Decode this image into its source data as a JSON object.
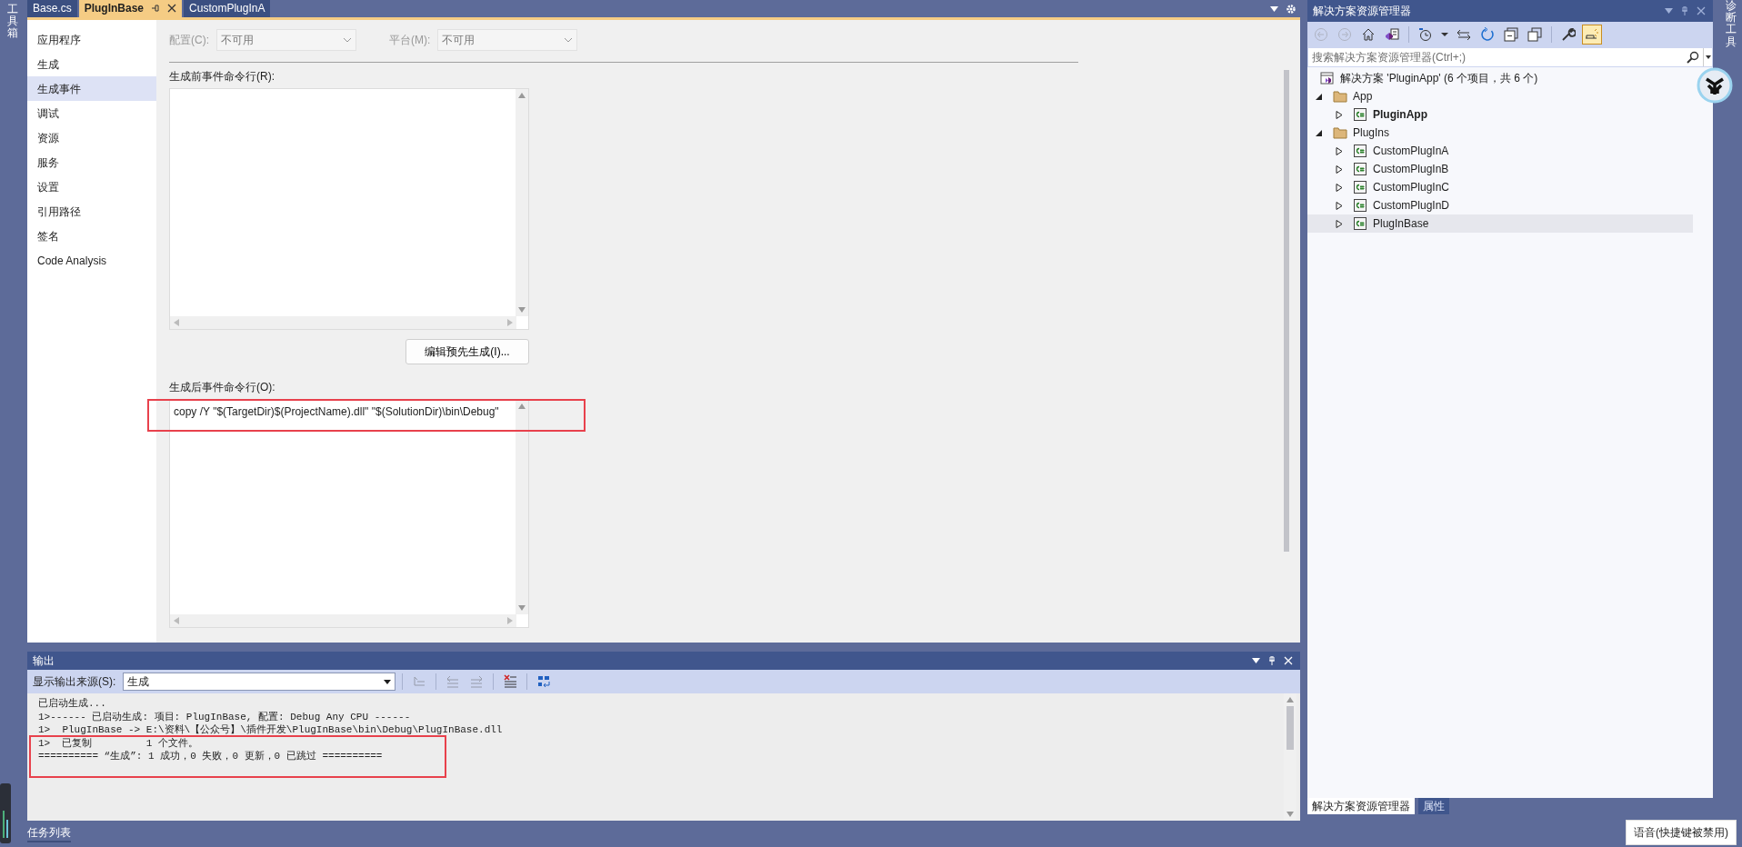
{
  "left_strip": {
    "label": "工具箱"
  },
  "doc_tabs": [
    {
      "label": "Base.cs",
      "selected": false
    },
    {
      "label": "PlugInBase",
      "selected": true
    },
    {
      "label": "CustomPlugInA",
      "selected": false
    }
  ],
  "nav": [
    {
      "label": "应用程序",
      "selected": false
    },
    {
      "label": "生成",
      "selected": false
    },
    {
      "label": "生成事件",
      "selected": true
    },
    {
      "label": "调试",
      "selected": false
    },
    {
      "label": "资源",
      "selected": false
    },
    {
      "label": "服务",
      "selected": false
    },
    {
      "label": "设置",
      "selected": false
    },
    {
      "label": "引用路径",
      "selected": false
    },
    {
      "label": "签名",
      "selected": false
    },
    {
      "label": "Code Analysis",
      "selected": false
    }
  ],
  "config": {
    "config_label": "配置(C):",
    "config_value": "不可用",
    "platform_label": "平台(M):",
    "platform_value": "不可用",
    "disabled": true
  },
  "pre_build": {
    "label": "生成前事件命令行(R):",
    "button": "编辑预先生成(I)..."
  },
  "post_build": {
    "label": "生成后事件命令行(O):",
    "value": "copy /Y \"$(TargetDir)$(ProjectName).dll\" \"$(SolutionDir)\\bin\\Debug\"",
    "highlighted": true
  },
  "output": {
    "title": "输出",
    "source_label": "显示输出来源(S):",
    "source_value": "生成",
    "toolbar": [
      {
        "kind": "find",
        "disabled": true
      },
      {
        "kind": "prev",
        "disabled": true
      },
      {
        "kind": "next",
        "disabled": true
      },
      {
        "kind": "clear",
        "disabled": false
      },
      {
        "kind": "wrap",
        "disabled": false
      }
    ],
    "lines": [
      {
        "text": "已启动生成...",
        "highlighted": false
      },
      {
        "text": "1>------ 已启动生成: 项目: PlugInBase, 配置: Debug Any CPU ------",
        "highlighted": false
      },
      {
        "text": "1>  PlugInBase -> E:\\资料\\【公众号】\\插件开发\\PlugInBase\\bin\\Debug\\PlugInBase.dll",
        "highlighted": false
      },
      {
        "text": "1>  已复制         1 个文件。",
        "highlighted": true
      },
      {
        "text": "========== “生成”: 1 成功，0 失败，0 更新，0 已跳过 ==========",
        "highlighted": true
      }
    ]
  },
  "bottom_tab": {
    "label": "任务列表"
  },
  "solution_explorer": {
    "title": "解决方案资源管理器",
    "toolbar": [
      {
        "kind": "back",
        "disabled": true,
        "selected": false
      },
      {
        "kind": "forward",
        "disabled": true,
        "selected": false
      },
      {
        "kind": "home",
        "disabled": false,
        "selected": false
      },
      {
        "kind": "solution",
        "disabled": false,
        "selected": false
      },
      {
        "kind": "history",
        "disabled": false,
        "selected": false
      },
      {
        "kind": "caret",
        "disabled": false,
        "selected": false
      },
      {
        "kind": "sync",
        "disabled": false,
        "selected": false
      },
      {
        "kind": "refresh",
        "disabled": false,
        "selected": false
      },
      {
        "kind": "collapse",
        "disabled": false,
        "selected": false
      },
      {
        "kind": "showall",
        "disabled": false,
        "selected": false
      },
      {
        "kind": "wrench",
        "disabled": false,
        "selected": false
      },
      {
        "kind": "preview",
        "disabled": false,
        "selected": true
      }
    ],
    "search_placeholder": "搜索解决方案资源管理器(Ctrl+;)",
    "tree": [
      {
        "label": "解决方案 'PluginApp' (6 个项目，共 6 个)",
        "kind": "solution",
        "selected": false,
        "children": [
          {
            "label": "App",
            "kind": "folder",
            "expanded": true,
            "selected": false,
            "children": [
              {
                "label": "PluginApp",
                "kind": "project",
                "expanded": false,
                "bold": true,
                "selected": false
              }
            ]
          },
          {
            "label": "PlugIns",
            "kind": "folder",
            "expanded": true,
            "selected": false,
            "children": [
              {
                "label": "CustomPlugInA",
                "kind": "project",
                "expanded": false,
                "bold": false,
                "selected": false
              },
              {
                "label": "CustomPlugInB",
                "kind": "project",
                "expanded": false,
                "bold": false,
                "selected": false
              },
              {
                "label": "CustomPlugInC",
                "kind": "project",
                "expanded": false,
                "bold": false,
                "selected": false
              },
              {
                "label": "CustomPlugInD",
                "kind": "project",
                "expanded": false,
                "bold": false,
                "selected": false
              },
              {
                "label": "PlugInBase",
                "kind": "project",
                "expanded": false,
                "bold": false,
                "selected": true
              }
            ]
          }
        ]
      }
    ],
    "tabs": [
      {
        "label": "解决方案资源管理器",
        "selected": true
      },
      {
        "label": "属性",
        "selected": false
      }
    ]
  },
  "right_strip": {
    "label": "诊断工具"
  },
  "tooltip": "语音(快捷键被禁用)"
}
